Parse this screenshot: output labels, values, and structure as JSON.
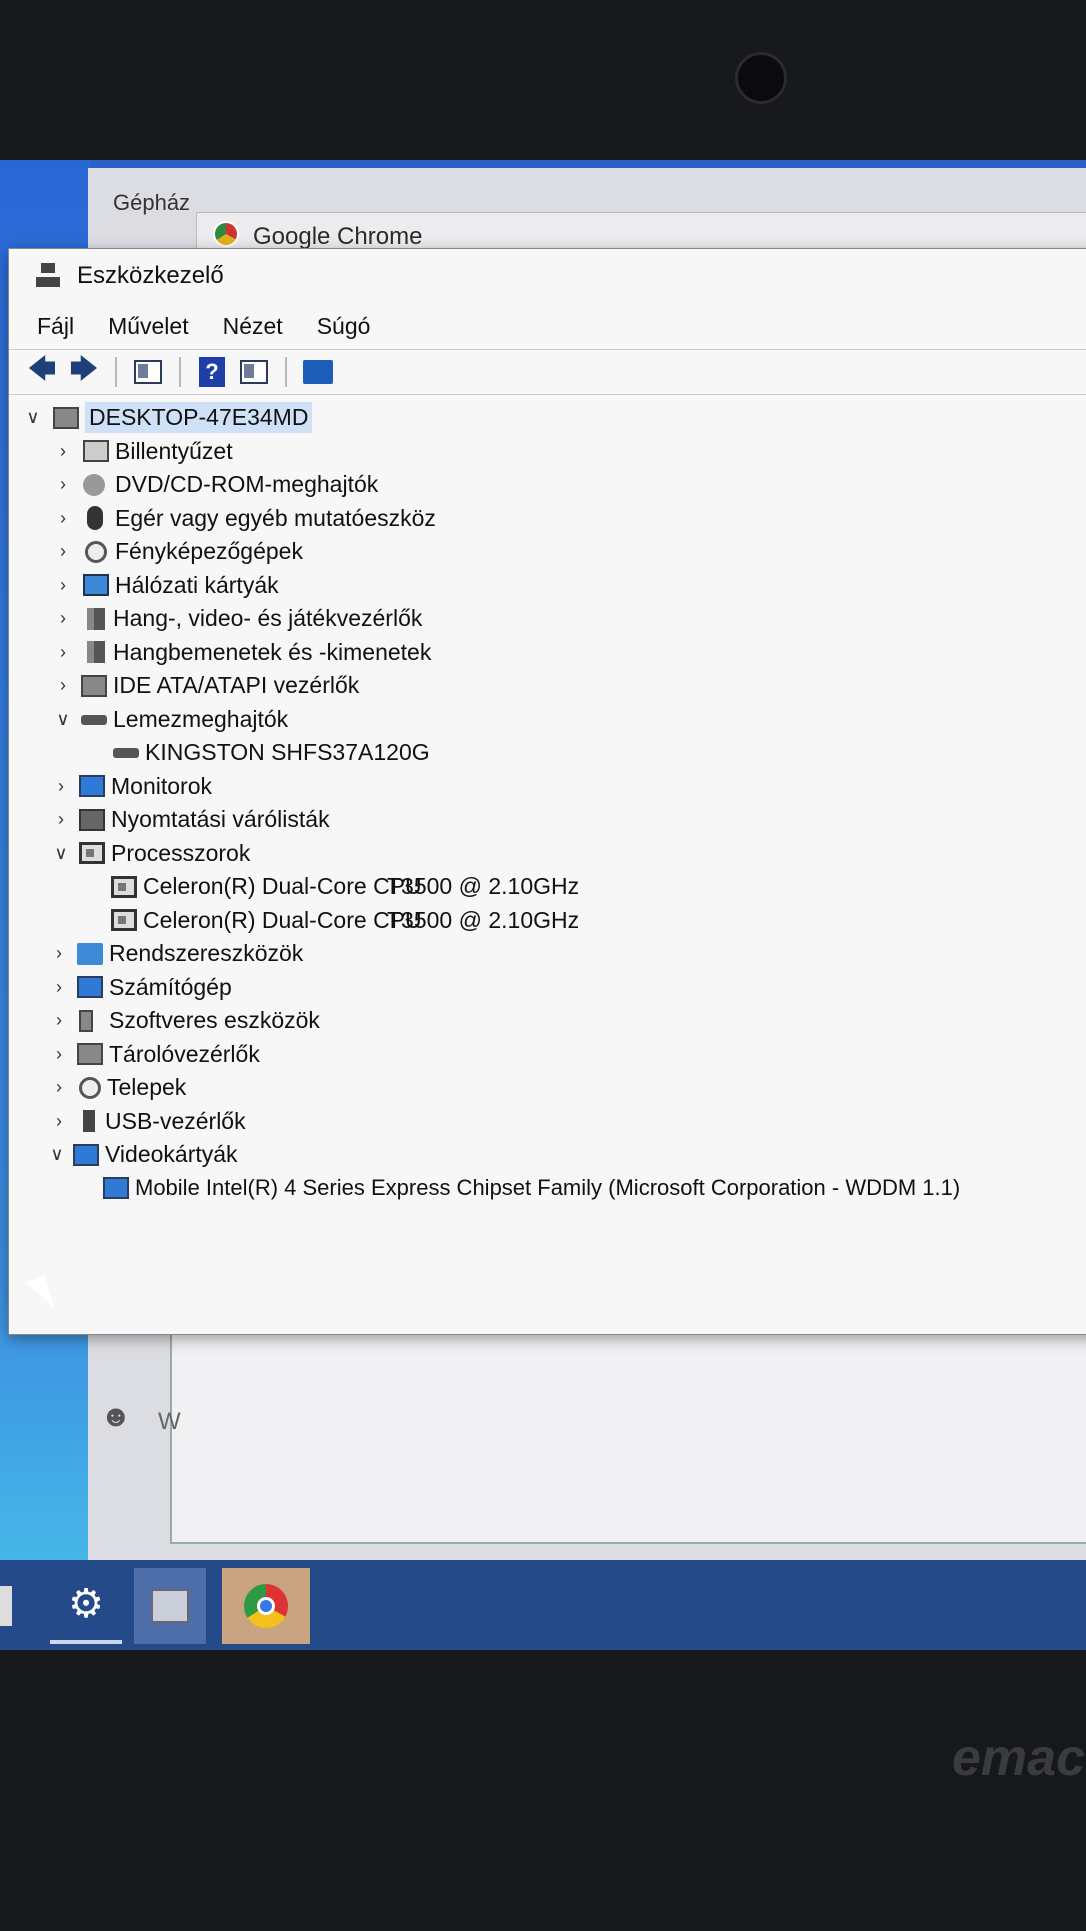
{
  "background_window": {
    "title": "Gépház"
  },
  "chrome_window": {
    "title": "Google Chrome"
  },
  "device_manager": {
    "title": "Eszközkezelő",
    "menu": [
      "Fájl",
      "Művelet",
      "Nézet",
      "Súgó"
    ],
    "toolbar": {
      "help_label": "?"
    },
    "root": "DESKTOP-47E34MD",
    "categories": [
      "Billentyűzet",
      "DVD/CD-ROM-meghajtók",
      "Egér vagy egyéb mutatóeszköz",
      "Fényképezőgépek",
      "Hálózati kártyák",
      "Hang-, video- és játékvezérlők",
      "Hangbemenetek és -kimenetek",
      "IDE ATA/ATAPI vezérlők",
      "Lemezmeghajtók",
      "Monitorok",
      "Nyomtatási várólisták",
      "Processzorok",
      "Rendszereszközök",
      "Számítógép",
      "Szoftveres eszközök",
      "Tárolóvezérlők",
      "Telepek",
      "USB-vezérlők",
      "Videokártyák"
    ],
    "disk_children": [
      "KINGSTON SHFS37A120G"
    ],
    "cpu_children": [
      {
        "name": "Celeron(R) Dual-Core CPU",
        "detail": "T3500  @ 2.10GHz"
      },
      {
        "name": "Celeron(R) Dual-Core CPU",
        "detail": "T3500  @ 2.10GHz"
      }
    ],
    "video_children": [
      "Mobile Intel(R) 4 Series Express Chipset Family (Microsoft Corporation - WDDM 1.1)"
    ]
  },
  "underlying": {
    "text": "W"
  },
  "laptop_brand": "emac"
}
